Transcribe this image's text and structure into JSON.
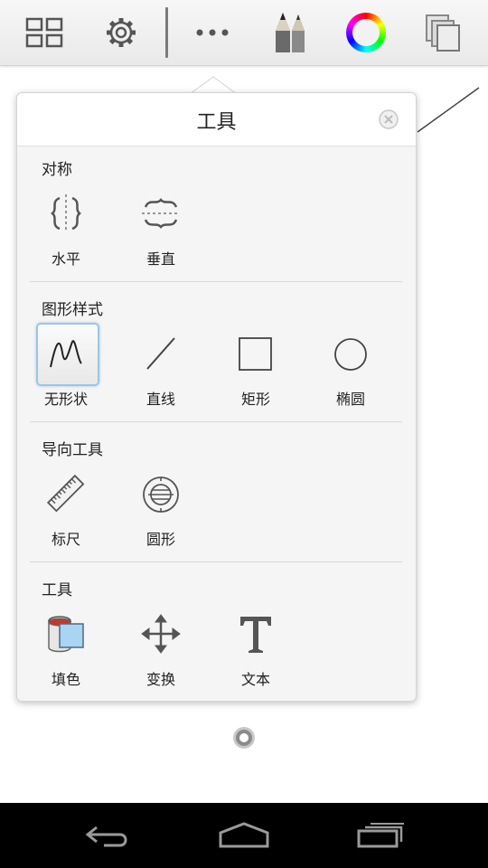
{
  "toolbar": {
    "icons": [
      "grid-icon",
      "gear-icon",
      "more-icon",
      "brushes-icon",
      "color-wheel-icon",
      "layers-icon"
    ]
  },
  "popover": {
    "title": "工具",
    "sections": [
      {
        "title": "对称",
        "tools": [
          {
            "label": "水平",
            "icon": "symmetry-horizontal-icon"
          },
          {
            "label": "垂直",
            "icon": "symmetry-vertical-icon"
          }
        ]
      },
      {
        "title": "图形样式",
        "tools": [
          {
            "label": "无形状",
            "icon": "freeform-icon"
          },
          {
            "label": "直线",
            "icon": "line-icon"
          },
          {
            "label": "矩形",
            "icon": "rectangle-icon"
          },
          {
            "label": "椭圆",
            "icon": "ellipse-icon"
          }
        ]
      },
      {
        "title": "导向工具",
        "tools": [
          {
            "label": "标尺",
            "icon": "ruler-icon"
          },
          {
            "label": "圆形",
            "icon": "circle-guide-icon"
          }
        ]
      },
      {
        "title": "工具",
        "tools": [
          {
            "label": "填色",
            "icon": "fill-bucket-icon"
          },
          {
            "label": "变换",
            "icon": "transform-icon"
          },
          {
            "label": "文本",
            "icon": "text-icon"
          }
        ]
      }
    ]
  },
  "colors": {
    "selected_border": "#9cc5e6",
    "fill_blue": "#a9d4f2"
  }
}
